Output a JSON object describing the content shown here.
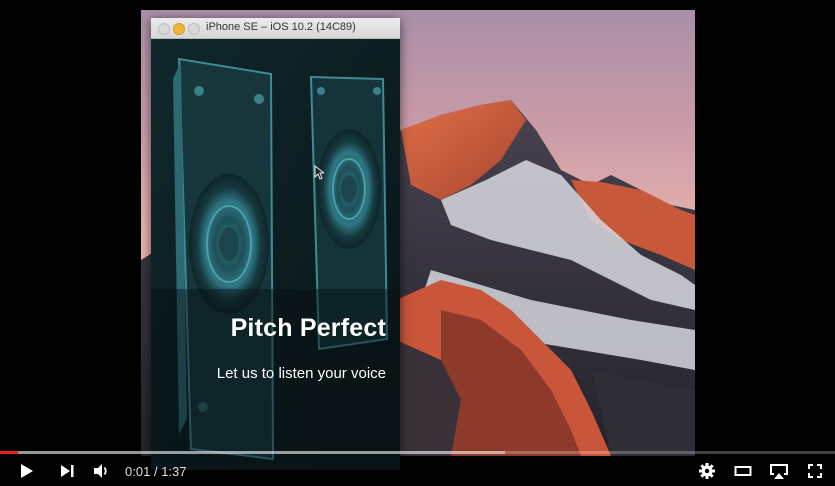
{
  "simulator": {
    "window_title": "iPhone SE – iOS 10.2 (14C89)"
  },
  "app": {
    "title": "Pitch Perfect",
    "subtitle": "Let us to listen your voice"
  },
  "player": {
    "current_time": "0:01",
    "separator": "/",
    "duration": "1:37",
    "progress_played_fraction": 0.021,
    "progress_loaded_fraction": 0.605,
    "accent_color": "#e62117",
    "controls": [
      "play-icon",
      "next-icon",
      "volume-icon",
      "settings-icon",
      "theater-mode-icon",
      "airplay-icon",
      "fullscreen-icon"
    ]
  },
  "colors": {
    "sky_top": "#b48a9e",
    "sky_glow": "#e8b4b0",
    "mountain_lit": "#d9633d",
    "mountain_shadow": "#3c3a44",
    "app_background": "#0e2226"
  }
}
